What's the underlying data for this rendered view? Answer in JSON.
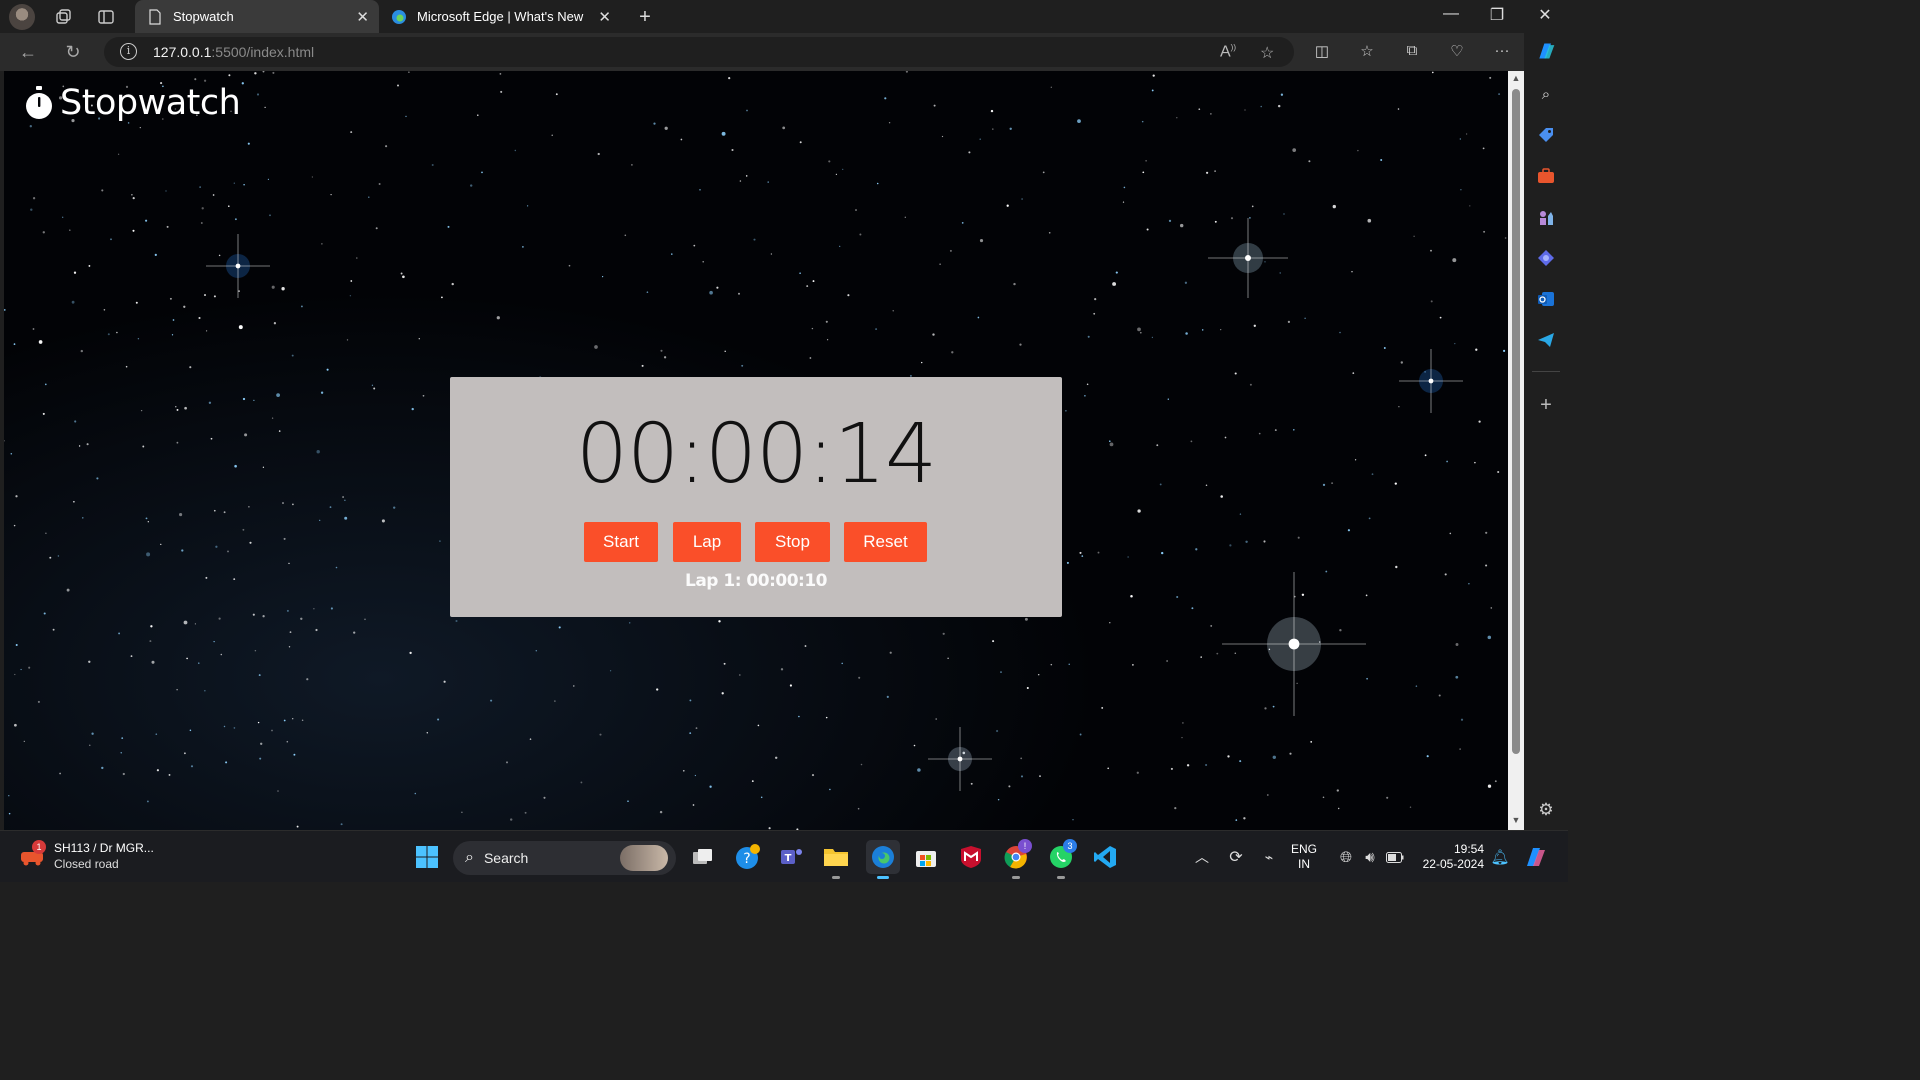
{
  "browser": {
    "tabs": [
      {
        "title": "Stopwatch",
        "active": true
      },
      {
        "title": "Microsoft Edge | What's New",
        "active": false
      }
    ],
    "url": {
      "host": "127.0.0.1",
      "rest": ":5500/index.html"
    },
    "read_aloud_label": "A",
    "window_controls": [
      "minimize-icon",
      "restore-icon",
      "close-icon"
    ]
  },
  "page": {
    "logo_title": "Stopwatch",
    "timer": "00:00:14",
    "buttons": {
      "start": "Start",
      "lap": "Lap",
      "stop": "Stop",
      "reset": "Reset"
    },
    "laps": [
      "Lap 1: 00:00:10"
    ],
    "card_color": "#c2bebd",
    "button_color": "#fa4f29"
  },
  "sidebar": {
    "icons": [
      "search-icon",
      "tag-icon",
      "briefcase-icon",
      "chess-icon",
      "copilot-icon",
      "outlook-icon",
      "telegram-icon",
      "add-icon",
      "settings-icon"
    ]
  },
  "taskbar": {
    "weather": {
      "title": "SH113 / Dr MGR...",
      "subtitle": "Closed road",
      "badge": "1"
    },
    "search_placeholder": "Search",
    "apps": [
      {
        "name": "start-icon"
      },
      {
        "name": "task-view-icon"
      },
      {
        "name": "help-icon"
      },
      {
        "name": "teams-icon"
      },
      {
        "name": "file-explorer-icon"
      },
      {
        "name": "edge-icon"
      },
      {
        "name": "store-icon"
      },
      {
        "name": "mcafee-icon"
      },
      {
        "name": "chrome-icon",
        "badge": "!"
      },
      {
        "name": "whatsapp-icon",
        "badge": "3"
      },
      {
        "name": "vscode-icon"
      }
    ],
    "lang": {
      "line1": "ENG",
      "line2": "IN"
    },
    "time": "19:54",
    "date": "22-05-2024"
  }
}
